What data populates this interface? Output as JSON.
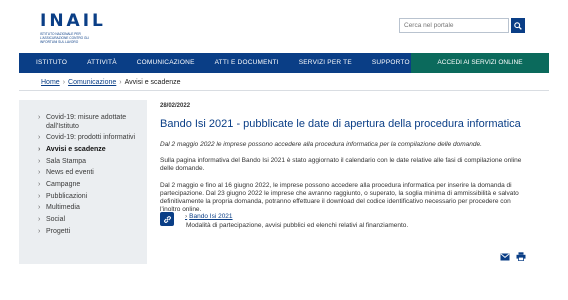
{
  "header": {
    "logo_text": "INAIL",
    "logo_subtitle": "Istituto Nazionale per l'Assicurazione contro gli Infortuni sul Lavoro",
    "search": {
      "placeholder": "Cerca nel portale",
      "icon": "search-icon"
    }
  },
  "nav": {
    "items": [
      "Istituto",
      "Attività",
      "Comunicazione",
      "Atti e documenti",
      "Servizi per te",
      "Supporto"
    ],
    "cta": "Accedi ai servizi online"
  },
  "breadcrumb": [
    "Home",
    "Comunicazione",
    "Avvisi e scadenze"
  ],
  "sidebar": {
    "items": [
      {
        "label": "Covid-19: misure adottate dall'Istituto",
        "active": false
      },
      {
        "label": "Covid-19: prodotti informativi",
        "active": false
      },
      {
        "label": "Avvisi e scadenze",
        "active": true
      },
      {
        "label": "Sala Stampa",
        "active": false
      },
      {
        "label": "News ed eventi",
        "active": false
      },
      {
        "label": "Campagne",
        "active": false
      },
      {
        "label": "Pubblicazioni",
        "active": false
      },
      {
        "label": "Multimedia",
        "active": false
      },
      {
        "label": "Social",
        "active": false
      },
      {
        "label": "Progetti",
        "active": false
      }
    ]
  },
  "article": {
    "date": "28/02/2022",
    "title": "Bando Isi 2021 - pubblicate le date di apertura della procedura informatica",
    "lead": "Dal 2 maggio 2022 le imprese possono accedere alla procedura informatica per la compilazione delle domande.",
    "paragraph1": "Sulla pagina informativa del Bando Isi 2021 è stato aggiornato il calendario con le date relative alle fasi di compilazione online delle domande.",
    "paragraph2": "Dal 2 maggio e fino al 16 giugno 2022, le imprese possono accedere alla procedura informatica per inserire la domanda di partecipazione. Dal 23 giugno 2022 le imprese che avranno raggiunto, o superato, la soglia minima di ammissibilità e salvato definitivamente la propria domanda, potranno effettuare il download del codice identificativo necessario per procedere con l'inoltro online."
  },
  "attachment": {
    "icon": "link-icon",
    "link": "Bando Isi 2021",
    "description": "Modalità di partecipazione, avvisi pubblici ed elenchi relativi al finanziamento."
  },
  "tools": {
    "email_icon": "email-icon",
    "print_icon": "print-icon"
  },
  "colors": {
    "brand": "#0a3e86",
    "cta": "#0b6a5c",
    "sidebar_bg": "#ebeef1"
  }
}
